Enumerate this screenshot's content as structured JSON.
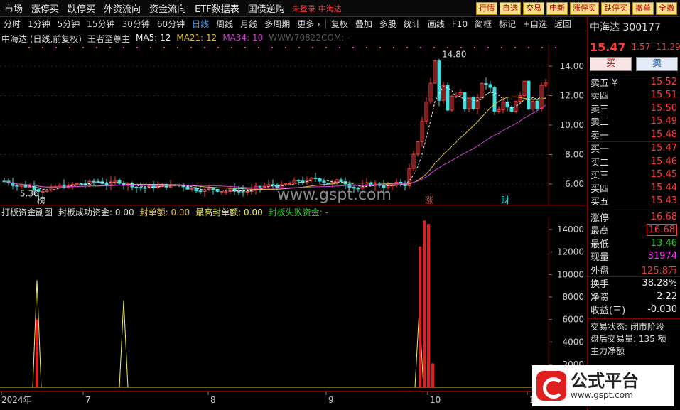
{
  "menu": {
    "items": [
      "市场",
      "涨停买",
      "跌停买",
      "外资流向",
      "资金流向",
      "ETF数据表",
      "国债逆购"
    ],
    "login_tag": "未登录",
    "stock_tag": "中海达"
  },
  "quick_buttons": [
    "行情",
    "自选",
    "交易",
    "申新",
    "涨停买",
    "跌停买",
    "撤单",
    "全撤"
  ],
  "period_bar": {
    "items": [
      "分时",
      "1分钟",
      "5分钟",
      "15分钟",
      "30分钟",
      "60分钟",
      "日线",
      "周线",
      "月线",
      "多周期",
      "更多 ›"
    ],
    "active": "日线",
    "tools": [
      "复权",
      "叠加",
      "多股",
      "统计",
      "画线",
      "F10",
      "简框",
      "标记",
      "+自选",
      "返回"
    ]
  },
  "main_legend": {
    "title": "中海达 (日线,前复权)",
    "indicator": "王者至尊主",
    "ma5": "MA5: 12",
    "ma21": "MA21: 12",
    "ma34": "MA34: 10",
    "extra": "WWW70822COM: -"
  },
  "sub_legend": {
    "title": "打板资金副图",
    "f1": "封板成功资金: 0.00",
    "f2": "封单额: 0.00",
    "f3": "最高封单额: 0.00",
    "f4": "封板失败资金: -"
  },
  "price_axis": [
    "14.00",
    "12.00",
    "10.00",
    "8.00",
    "6.00"
  ],
  "sub_axis": [
    "14000",
    "12000",
    "10000",
    "8000",
    "6000",
    "4000",
    "2000"
  ],
  "time_axis": [
    "2024年",
    "7",
    "8",
    "9",
    "10",
    "1"
  ],
  "annotations": {
    "high": "14.80",
    "low": "5.36",
    "zhang": "涨",
    "cai": "财",
    "bang": "榜"
  },
  "watermark": "www.gspt.com",
  "colors": {
    "red": "#ff3b3b",
    "green": "#2ec82e",
    "ma21": "#e0c040",
    "ma34": "#d040d0",
    "cyan": "#40e0e0"
  },
  "stock": {
    "name": "中海达",
    "code": "300177",
    "price": "15.47",
    "change": "1.57",
    "pct": "11.29"
  },
  "trade_buttons": {
    "buy": "买",
    "sell": "卖"
  },
  "order_book": {
    "asks": [
      {
        "l": "卖五 ¥",
        "p": "15.52"
      },
      {
        "l": "卖四",
        "p": "15.51"
      },
      {
        "l": "卖三",
        "p": "15.50"
      },
      {
        "l": "卖二",
        "p": "15.49"
      },
      {
        "l": "卖一",
        "p": "15.48"
      }
    ],
    "bids": [
      {
        "l": "买一",
        "p": "15.47"
      },
      {
        "l": "买二",
        "p": "15.46"
      },
      {
        "l": "买三",
        "p": "15.45"
      },
      {
        "l": "买四",
        "p": "15.44"
      },
      {
        "l": "买五",
        "p": "15.43"
      }
    ]
  },
  "quote": [
    {
      "l": "涨停",
      "v": "16.68",
      "c": "red"
    },
    {
      "l": "最高",
      "v": "16.68",
      "c": "red box"
    },
    {
      "l": "最低",
      "v": "13.46",
      "c": "green"
    },
    {
      "l": "现量",
      "v": "31974",
      "c": "mag"
    },
    {
      "l": "外盘",
      "v": "125.8万",
      "c": "red"
    },
    {
      "l": "换手",
      "v": "38.28%",
      "c": "white"
    },
    {
      "l": "净资",
      "v": "2.22",
      "c": "white"
    },
    {
      "l": "收益(三)",
      "v": "-0.030",
      "c": "white"
    }
  ],
  "status": [
    "交易状态: 闭市阶段",
    "盘后交易量: 135 额",
    "主力净额"
  ],
  "logo": {
    "t1": "公式平台",
    "t2": "www.gspt.com"
  }
}
